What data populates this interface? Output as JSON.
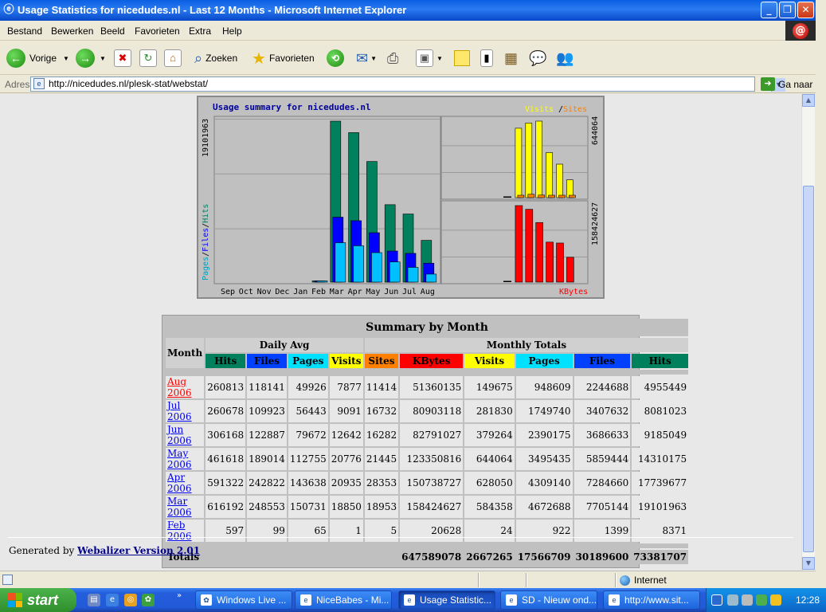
{
  "window": {
    "title": "Usage Statistics for nicedudes.nl - Last 12 Months - Microsoft Internet Explorer",
    "minimize": "_",
    "maximize": "❐",
    "close": "✕"
  },
  "menu": [
    "Bestand",
    "Bewerken",
    "Beeld",
    "Favorieten",
    "Extra",
    "Help"
  ],
  "toolbar": {
    "back_label": "Vorige",
    "search_label": "Zoeken",
    "favorites_label": "Favorieten"
  },
  "address": {
    "label": "Adres",
    "url": "http://nicedudes.nl/plesk-stat/webstat/",
    "go_label": "Ga naar"
  },
  "chart_data": {
    "type": "bar",
    "title": "Usage summary for nicedudes.nl",
    "legend_left": [
      "Pages",
      "Files",
      "Hits"
    ],
    "legend_top_right": [
      "Visits",
      "Sites"
    ],
    "legend_bottom_right": "KBytes",
    "max_hits_label": "19101963",
    "max_visits_label": "644064",
    "max_kbytes_label": "158424627",
    "categories": [
      "Sep",
      "Oct",
      "Nov",
      "Dec",
      "Jan",
      "Feb",
      "Mar",
      "Apr",
      "May",
      "Jun",
      "Jul",
      "Aug"
    ],
    "series": [
      {
        "name": "Hits",
        "values": [
          0,
          0,
          0,
          0,
          0,
          8371,
          19101963,
          17739677,
          14310175,
          9185049,
          8081023,
          4955449
        ]
      },
      {
        "name": "Files",
        "values": [
          0,
          0,
          0,
          0,
          0,
          1399,
          7705144,
          7284660,
          5859444,
          3686633,
          3407632,
          2244688
        ]
      },
      {
        "name": "Pages",
        "values": [
          0,
          0,
          0,
          0,
          0,
          922,
          4672688,
          4309140,
          3495435,
          2390175,
          1749740,
          948609
        ]
      },
      {
        "name": "Visits",
        "values": [
          0,
          0,
          0,
          0,
          0,
          24,
          584358,
          628050,
          644064,
          379264,
          281830,
          149675
        ]
      },
      {
        "name": "Sites",
        "values": [
          0,
          0,
          0,
          0,
          0,
          5,
          18953,
          28353,
          21445,
          16282,
          16732,
          11414
        ]
      },
      {
        "name": "KBytes",
        "values": [
          0,
          0,
          0,
          0,
          0,
          20628,
          158424627,
          150738727,
          123350816,
          82791027,
          80903118,
          51360135
        ]
      }
    ],
    "colors": {
      "hits": "#00805C",
      "files": "#0000FF",
      "pages": "#00C0FF",
      "visits": "#FFFF00",
      "sites": "#FF8000",
      "kbytes": "#FF0000"
    }
  },
  "summary": {
    "title": "Summary by Month",
    "month_header": "Month",
    "daily_avg": "Daily Avg",
    "monthly_totals": "Monthly Totals",
    "cols_daily": [
      "Hits",
      "Files",
      "Pages",
      "Visits"
    ],
    "cols_monthly": [
      "Sites",
      "KBytes",
      "Visits",
      "Pages",
      "Files",
      "Hits"
    ],
    "rows": [
      {
        "month": "Aug 2006",
        "d": [
          "260813",
          "118141",
          "49926",
          "7877"
        ],
        "m": [
          "11414",
          "51360135",
          "149675",
          "948609",
          "2244688",
          "4955449"
        ]
      },
      {
        "month": "Jul 2006",
        "d": [
          "260678",
          "109923",
          "56443",
          "9091"
        ],
        "m": [
          "16732",
          "80903118",
          "281830",
          "1749740",
          "3407632",
          "8081023"
        ]
      },
      {
        "month": "Jun 2006",
        "d": [
          "306168",
          "122887",
          "79672",
          "12642"
        ],
        "m": [
          "16282",
          "82791027",
          "379264",
          "2390175",
          "3686633",
          "9185049"
        ]
      },
      {
        "month": "May 2006",
        "d": [
          "461618",
          "189014",
          "112755",
          "20776"
        ],
        "m": [
          "21445",
          "123350816",
          "644064",
          "3495435",
          "5859444",
          "14310175"
        ]
      },
      {
        "month": "Apr 2006",
        "d": [
          "591322",
          "242822",
          "143638",
          "20935"
        ],
        "m": [
          "28353",
          "150738727",
          "628050",
          "4309140",
          "7284660",
          "17739677"
        ]
      },
      {
        "month": "Mar 2006",
        "d": [
          "616192",
          "248553",
          "150731",
          "18850"
        ],
        "m": [
          "18953",
          "158424627",
          "584358",
          "4672688",
          "7705144",
          "19101963"
        ]
      },
      {
        "month": "Feb 2006",
        "d": [
          "597",
          "99",
          "65",
          "1"
        ],
        "m": [
          "5",
          "20628",
          "24",
          "922",
          "1399",
          "8371"
        ]
      }
    ],
    "totals_label": "Totals",
    "totals": [
      "647589078",
      "2667265",
      "17566709",
      "30189600",
      "73381707"
    ]
  },
  "footer": {
    "generated_by": "Generated by",
    "link": "Webalizer Version 2.01"
  },
  "status": {
    "zone": "Internet"
  },
  "taskbar": {
    "start": "start",
    "tasks": [
      "Windows Live ...",
      "NiceBabes - Mi...",
      "Usage Statistic...",
      "SD - Nieuw ond...",
      "http://www.sit..."
    ],
    "clock": "12:28"
  }
}
